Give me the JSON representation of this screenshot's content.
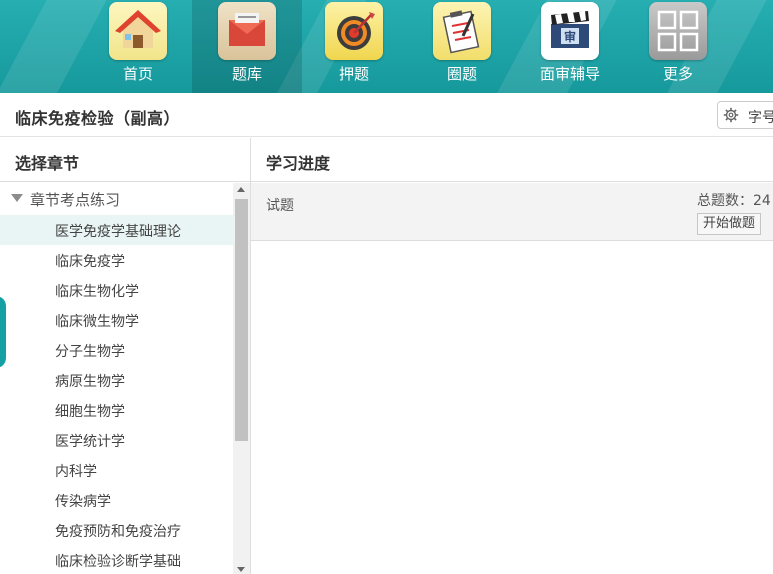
{
  "nav": {
    "items": [
      {
        "label": "首页",
        "icon": "home-icon"
      },
      {
        "label": "题库",
        "icon": "envelope-icon"
      },
      {
        "label": "押题",
        "icon": "target-icon"
      },
      {
        "label": "圈题",
        "icon": "clipboard-icon"
      },
      {
        "label": "面审辅导",
        "icon": "clapperboard-icon"
      },
      {
        "label": "更多",
        "icon": "grid-icon"
      }
    ],
    "active_index": 1,
    "colors": {
      "bar": "#16999c",
      "text": "#ffffff"
    }
  },
  "header": {
    "title": "临床免疫检验（副高）",
    "font_button_label": "字号"
  },
  "left_panel": {
    "title": "选择章节",
    "tree_root_label": "章节考点练习",
    "chapters": [
      "医学免疫学基础理论",
      "临床免疫学",
      "临床生物化学",
      "临床微生物学",
      "分子生物学",
      "病原生物学",
      "细胞生物学",
      "医学统计学",
      "内科学",
      "传染病学",
      "免疫预防和免疫治疗",
      "临床检验诊断学基础"
    ],
    "selected_index": 0
  },
  "right_panel": {
    "title": "学习进度",
    "row": {
      "label": "试题",
      "count_text": "总题数：24",
      "start_button": "开始做题"
    }
  }
}
